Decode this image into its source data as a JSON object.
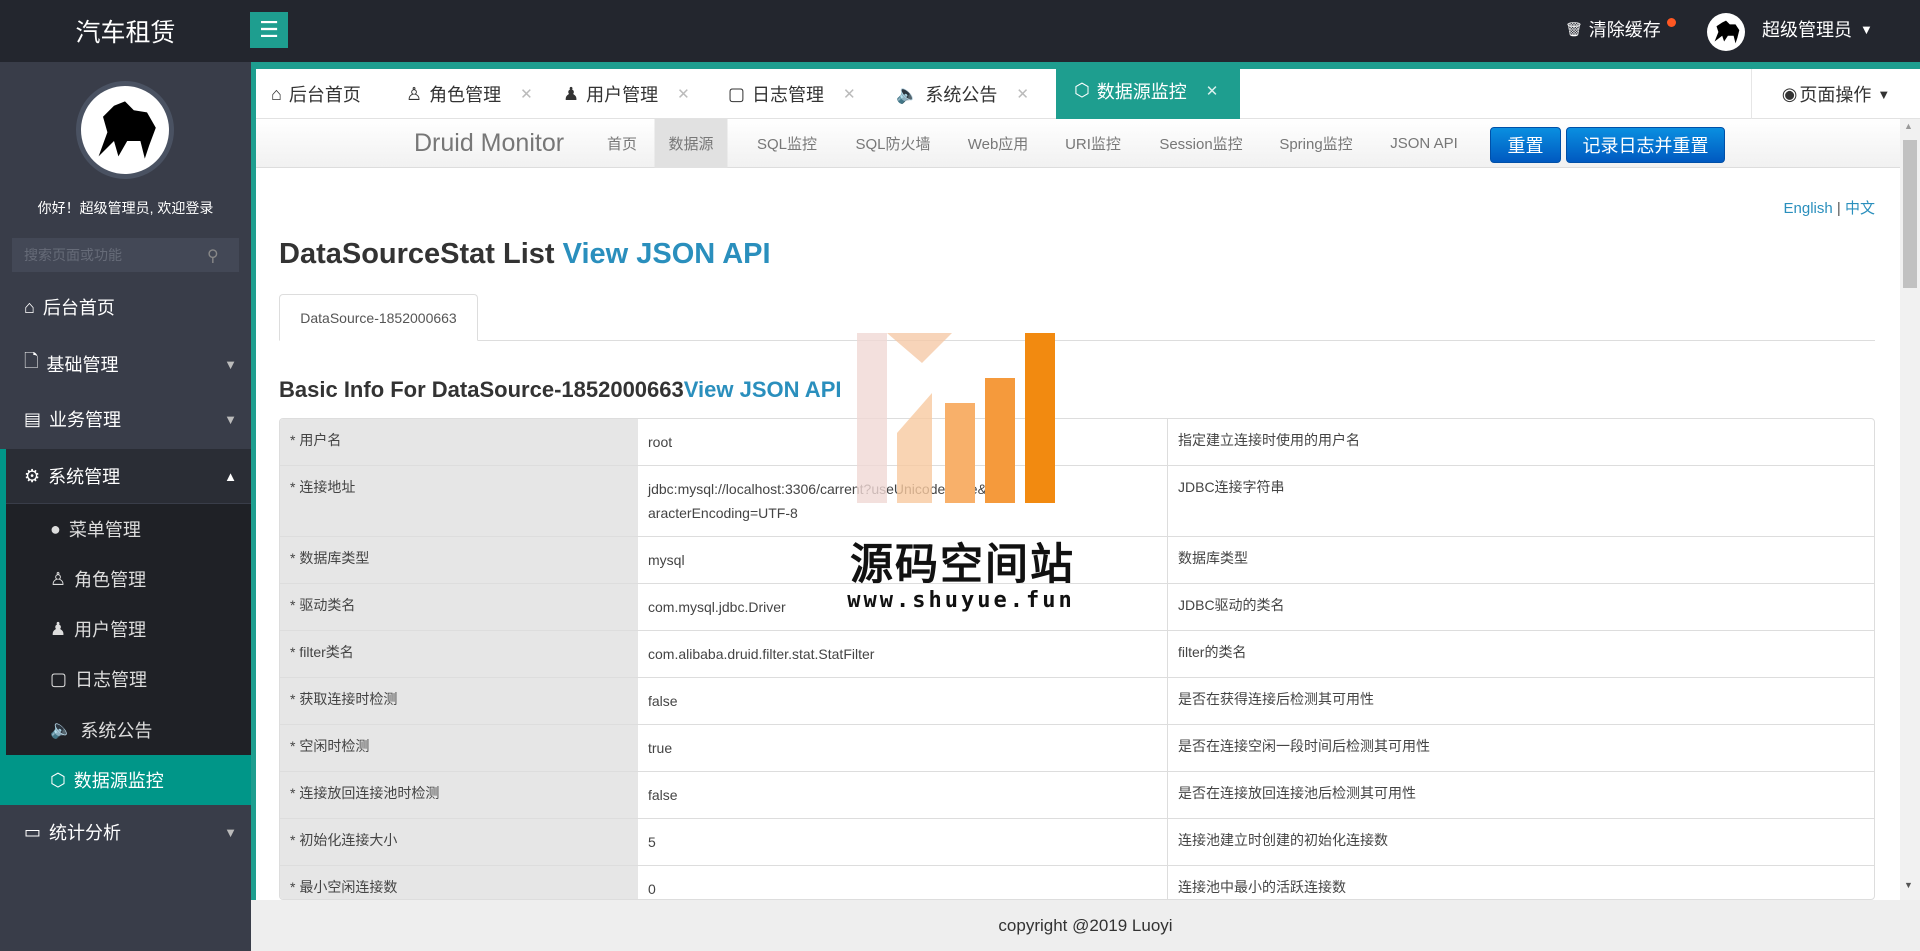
{
  "header": {
    "app_title": "汽车租赁",
    "menu_toggle": "☰",
    "clear_cache": "清除缓存",
    "user_name": "超级管理员"
  },
  "sidebar": {
    "greeting": "你好！超级管理员, 欢迎登录",
    "search_placeholder": "搜索页面或功能",
    "items": [
      {
        "label": "后台首页",
        "icon": "⌂"
      },
      {
        "label": "基础管理",
        "icon": "🗋"
      },
      {
        "label": "业务管理",
        "icon": "▤"
      },
      {
        "label": "系统管理",
        "icon": "⚙"
      },
      {
        "label": "统计分析",
        "icon": "▭"
      }
    ],
    "sub_items": [
      {
        "label": "菜单管理",
        "icon": "●"
      },
      {
        "label": "角色管理",
        "icon": "♙"
      },
      {
        "label": "用户管理",
        "icon": "♟"
      },
      {
        "label": "日志管理",
        "icon": "▢"
      },
      {
        "label": "系统公告",
        "icon": "🔈"
      },
      {
        "label": "数据源监控",
        "icon": "⬡"
      }
    ]
  },
  "tabs": [
    {
      "label": "后台首页",
      "icon": "⌂"
    },
    {
      "label": "角色管理",
      "icon": "♙"
    },
    {
      "label": "用户管理",
      "icon": "♟"
    },
    {
      "label": "日志管理",
      "icon": "▢"
    },
    {
      "label": "系统公告",
      "icon": "🔈"
    },
    {
      "label": "数据源监控",
      "icon": "⬡"
    }
  ],
  "page_ops": "页面操作",
  "druid": {
    "title": "Druid Monitor",
    "nav": [
      "首页",
      "数据源",
      "SQL监控",
      "SQL防火墙",
      "Web应用",
      "URI监控",
      "Session监控",
      "Spring监控",
      "JSON API"
    ],
    "reset": "重置",
    "log_reset": "记录日志并重置",
    "lang_en": "English",
    "lang_sep": "|",
    "lang_zh": "中文",
    "list_title": "DataSourceStat List ",
    "view_json": "View JSON API",
    "ds_tab": "DataSource-1852000663",
    "basic_title": "Basic Info For DataSource-1852000663",
    "rows": [
      [
        "* 用户名",
        "root",
        "指定建立连接时使用的用户名"
      ],
      [
        "* 连接地址",
        "jdbc:mysql://localhost:3306/carrent?useUnicode=true&characterEncoding=UTF-8",
        "JDBC连接字符串"
      ],
      [
        "* 数据库类型",
        "mysql",
        "数据库类型"
      ],
      [
        "* 驱动类名",
        "com.mysql.jdbc.Driver",
        "JDBC驱动的类名"
      ],
      [
        "* filter类名",
        "com.alibaba.druid.filter.stat.StatFilter",
        "filter的类名"
      ],
      [
        "* 获取连接时检测",
        "false",
        "是否在获得连接后检测其可用性"
      ],
      [
        "* 空闲时检测",
        "true",
        "是否在连接空闲一段时间后检测其可用性"
      ],
      [
        "* 连接放回连接池时检测",
        "false",
        "是否在连接放回连接池后检测其可用性"
      ],
      [
        "* 初始化连接大小",
        "5",
        "连接池建立时创建的初始化连接数"
      ],
      [
        "* 最小空闲连接数",
        "0",
        "连接池中最小的活跃连接数"
      ]
    ]
  },
  "footer": "copyright @2019 Luoyi",
  "watermark": {
    "title": "源码空间站",
    "url": "www.shuyue.fun"
  }
}
